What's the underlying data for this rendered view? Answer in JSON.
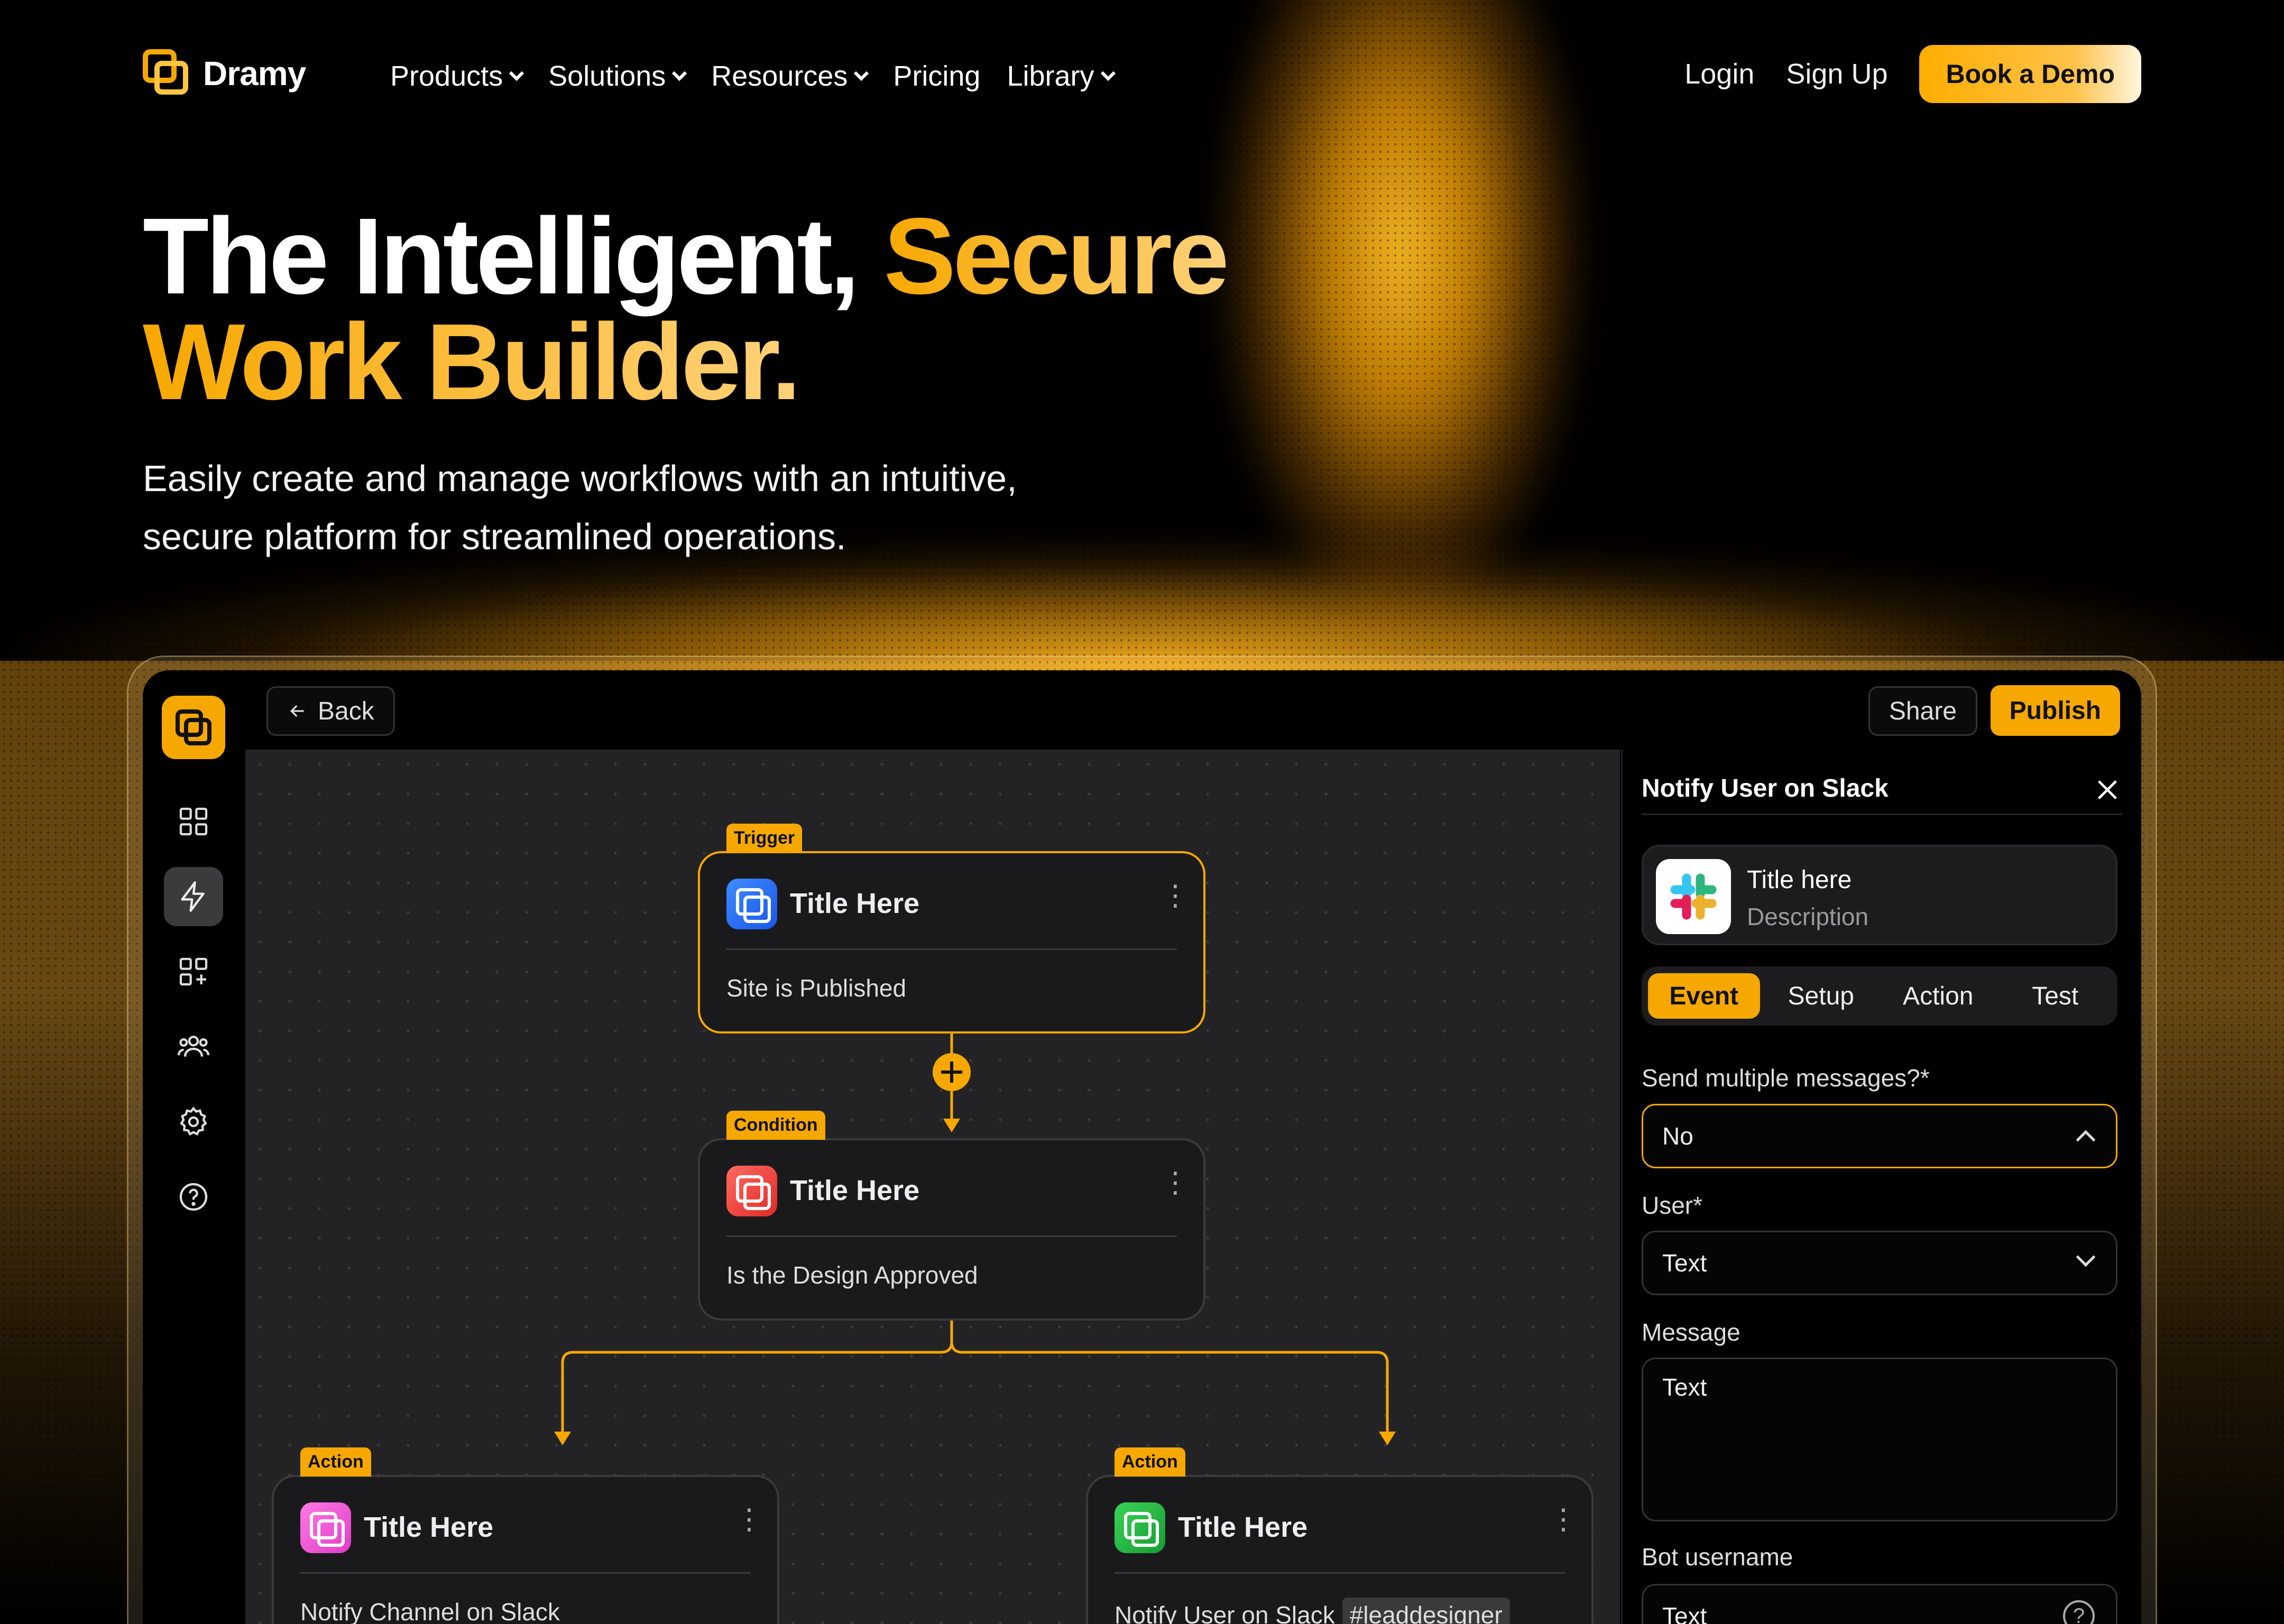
{
  "brand": {
    "name": "Dramy",
    "accent": "#f7a800"
  },
  "nav": {
    "menu": [
      {
        "label": "Products",
        "dropdown": true
      },
      {
        "label": "Solutions",
        "dropdown": true
      },
      {
        "label": "Resources",
        "dropdown": true
      },
      {
        "label": "Pricing",
        "dropdown": false
      },
      {
        "label": "Library",
        "dropdown": true
      }
    ],
    "login": "Login",
    "signup": "Sign Up",
    "cta": "Book a Demo"
  },
  "hero": {
    "title_part1": "The Intelligent, ",
    "title_highlight1": "Secure",
    "title_highlight2": "Work Builder.",
    "subtitle_line1": "Easily create and manage workflows with an intuitive,",
    "subtitle_line2": "secure platform for streamlined operations."
  },
  "app": {
    "rail_icons": [
      "grid-icon",
      "lightning-icon",
      "add-apps-icon",
      "users-icon",
      "gear-icon",
      "help-icon"
    ],
    "rail_active": "lightning-icon",
    "topbar": {
      "back": "Back",
      "share": "Share",
      "publish": "Publish"
    },
    "nodes": [
      {
        "tag": "Trigger",
        "title": "Title Here",
        "body": "Site is Published",
        "icon_color": "blue",
        "selected": true
      },
      {
        "tag": "Condition",
        "title": "Title Here",
        "body": "Is the Design Approved",
        "icon_color": "red",
        "selected": false
      },
      {
        "tag": "Action",
        "title": "Title Here",
        "body": "Notify Channel on Slack",
        "icon_color": "pink",
        "selected": false
      },
      {
        "tag": "Action",
        "title": "Title Here",
        "body": "Notify User on Slack",
        "chip": "#leaddesigner",
        "icon_color": "green",
        "selected": false
      }
    ],
    "panel": {
      "title": "Notify User on Slack",
      "app_card": {
        "title": "Title here",
        "description": "Description"
      },
      "tabs": [
        {
          "label": "Event",
          "active": true
        },
        {
          "label": "Setup",
          "active": false
        },
        {
          "label": "Action",
          "active": false
        },
        {
          "label": "Test",
          "active": false
        }
      ],
      "fields": [
        {
          "label": "Send multiple messages?*",
          "value": "No",
          "type": "select-open"
        },
        {
          "label": "User*",
          "value": "Text",
          "type": "select"
        },
        {
          "label": "Message",
          "value": "Text",
          "type": "textarea"
        },
        {
          "label": "Bot username",
          "value": "Text",
          "type": "text-help"
        }
      ]
    }
  }
}
